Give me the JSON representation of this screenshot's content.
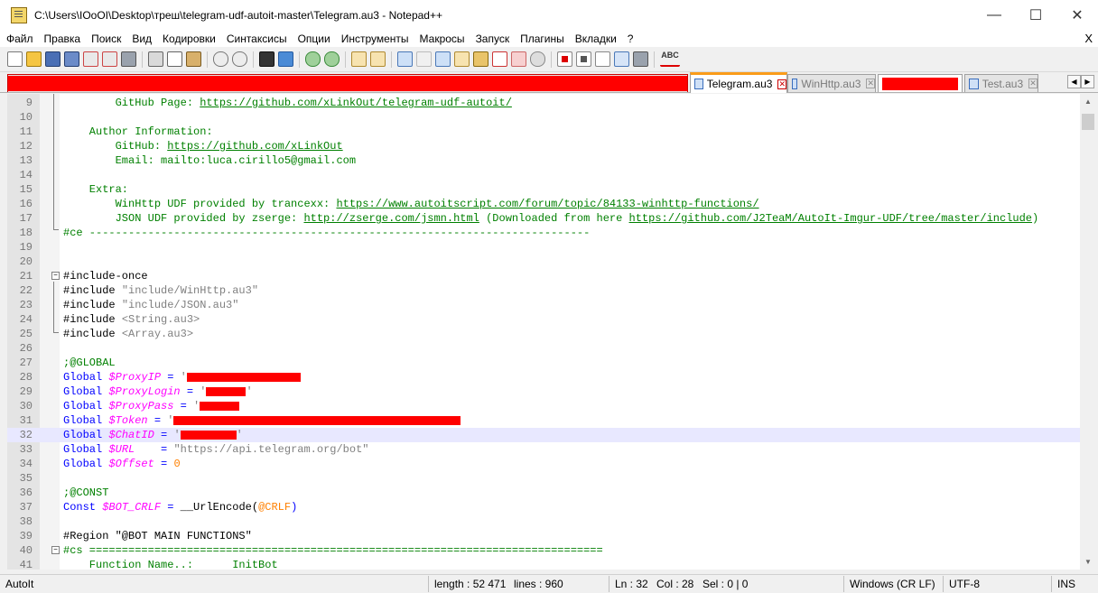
{
  "window": {
    "title": "C:\\Users\\IOoOI\\Desktop\\треш\\telegram-udf-autoit-master\\Telegram.au3 - Notepad++",
    "minimize": "—",
    "maximize": "☐",
    "close": "✕"
  },
  "menu": {
    "items": [
      "Файл",
      "Правка",
      "Поиск",
      "Вид",
      "Кодировки",
      "Синтаксисы",
      "Опции",
      "Инструменты",
      "Макросы",
      "Запуск",
      "Плагины",
      "Вкладки",
      "?"
    ],
    "close_label": "X"
  },
  "toolbar_icons": [
    "new-file-icon",
    "open-file-icon",
    "save-icon",
    "save-all-icon",
    "close-icon",
    "close-all-icon",
    "print-icon",
    "cut-icon",
    "copy-icon",
    "paste-icon",
    "undo-icon",
    "redo-icon",
    "find-icon",
    "replace-icon",
    "zoom-in-icon",
    "zoom-out-icon",
    "sync-v-icon",
    "sync-h-icon",
    "wrap-icon",
    "all-chars-icon",
    "indent-guide-icon",
    "udl-icon",
    "doc-map-icon",
    "function-list-icon",
    "folder-workspace-icon",
    "monitor-icon",
    "record-macro-icon",
    "stop-macro-icon",
    "play-macro-icon",
    "run-macro-multiple-icon",
    "save-macro-icon",
    "spellcheck-icon"
  ],
  "spellcheck_label": "ABC",
  "tabs": [
    {
      "label": "Telegram.au3",
      "active": true
    },
    {
      "label": "WinHttp.au3",
      "active": false
    },
    {
      "label": "Test.au3",
      "active": false
    }
  ],
  "tab_close": "✕",
  "scroll": {
    "left": "◀",
    "right": "▶",
    "up": "▲",
    "down": "▼"
  },
  "editor": {
    "line_numbers": [
      "9",
      "10",
      "11",
      "12",
      "13",
      "14",
      "15",
      "16",
      "17",
      "18",
      "19",
      "20",
      "21",
      "22",
      "23",
      "24",
      "25",
      "26",
      "27",
      "28",
      "29",
      "30",
      "31",
      "32",
      "33",
      "34",
      "35",
      "36",
      "37",
      "38",
      "39",
      "40",
      "41"
    ],
    "current_line": "32",
    "fold_minus": "−",
    "lines": {
      "l9a": "        GitHub Page: ",
      "l9b": "https://github.com/xLinkOut/telegram-udf-autoit/",
      "l11": "    Author Information:",
      "l12a": "        GitHub: ",
      "l12b": "https://github.com/xLinkOut",
      "l13": "        Email: mailto:luca.cirillo5@gmail.com",
      "l15": "    Extra:",
      "l16a": "        WinHttp UDF provided by trancexx: ",
      "l16b": "https://www.autoitscript.com/forum/topic/84133-winhttp-functions/",
      "l17a": "        JSON UDF provided by zserge: ",
      "l17b": "http://zserge.com/jsmn.html",
      "l17c": " (Downloaded from here ",
      "l17d": "https://github.com/J2TeaM/AutoIt-Imgur-UDF/tree/master/include",
      "l17e": ")",
      "l18": "#ce -----------------------------------------------------------------------------",
      "l21": "#include-once",
      "inc_kw": "#include",
      "l22s": "\"include/WinHttp.au3\"",
      "l23s": "\"include/JSON.au3\"",
      "l24s": "<String.au3>",
      "l25s": "<Array.au3>",
      "l27": ";@GLOBAL",
      "global_kw": "Global",
      "v_proxyip": "$ProxyIP",
      "v_proxylogin": "$ProxyLogin",
      "v_proxypass": "$ProxyPass",
      "v_token": "$Token",
      "v_chatid": "$ChatID",
      "v_url": "$URL",
      "v_offset": "$Offset",
      "eq": " = ",
      "eq_url": "    = ",
      "quote": "'",
      "url_str": "\"https://api.telegram.org/bot\"",
      "zero": "0",
      "l36": ";@CONST",
      "const_kw": "Const",
      "v_bot_crlf": "$BOT_CRLF",
      "urlencode": "__UrlEncode(",
      "crlf_macro": "@CRLF",
      "close_paren": ")",
      "l39": "#Region \"@BOT MAIN FUNCTIONS\"",
      "l40": "#cs ===============================================================================",
      "l41": "    Function Name..:      InitBot"
    }
  },
  "statusbar": {
    "lang": "AutoIt",
    "length": "length : 52 471",
    "lines": "lines : 960",
    "ln": "Ln : 32",
    "col": "Col : 28",
    "sel": "Sel : 0 | 0",
    "eol": "Windows (CR LF)",
    "encoding": "UTF-8",
    "mode": "INS"
  }
}
